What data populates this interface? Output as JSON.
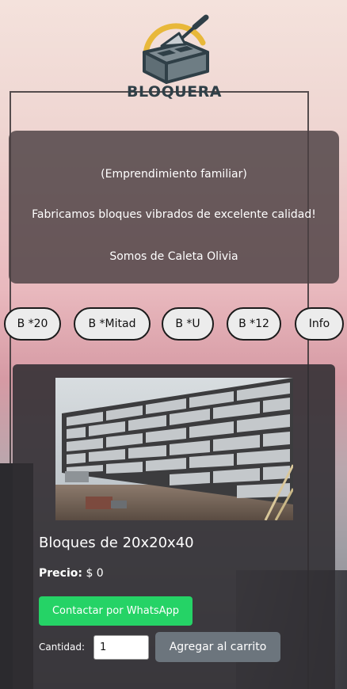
{
  "brand": {
    "name": "BLOQUERA"
  },
  "intro": {
    "line1": "(Emprendimiento familiar)",
    "line2": "Fabricamos bloques vibrados de excelente calidad!",
    "line3": "Somos de Caleta Olivia"
  },
  "nav": {
    "items": [
      "B *20",
      "B *Mitad",
      "B *U",
      "B *12",
      "Info"
    ]
  },
  "product": {
    "title": "Bloques de 20x20x40",
    "price_label": "Precio:",
    "price_value": "$ 0",
    "whatsapp_label": "Contactar por WhatsApp",
    "quantity_label": "Cantidad:",
    "quantity_value": "1",
    "add_to_cart_label": "Agregar al carrito"
  },
  "colors": {
    "whatsapp": "#25d366",
    "cart_button": "#6c757d",
    "logo_dark": "#2f3f47",
    "logo_accent": "#e8b83a"
  }
}
